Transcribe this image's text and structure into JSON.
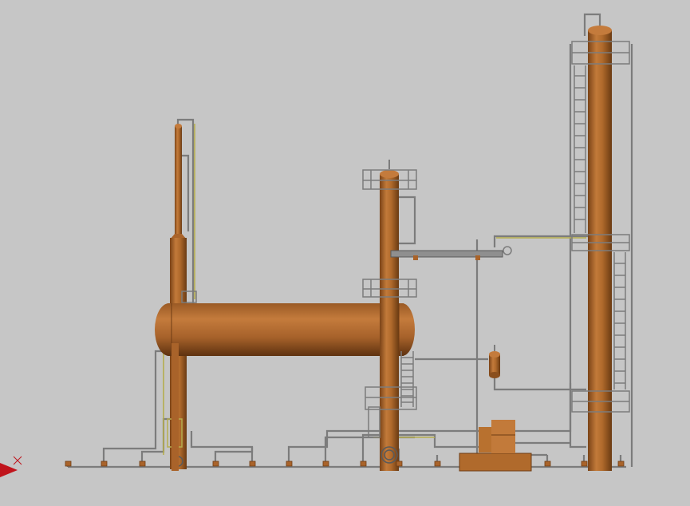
{
  "viewport": {
    "background": "#c6c6c6"
  },
  "colors": {
    "vessel_light": "#c47b3c",
    "vessel_mid": "#a9632a",
    "vessel_dark": "#6e3c14",
    "pipe": "#7c7c7c",
    "pipe_dark": "#5a5a5a",
    "steam_line": "#b5ad4e",
    "axis_red": "#c0141c"
  },
  "icons": {
    "view_triad": "red-axis-triad-icon"
  }
}
